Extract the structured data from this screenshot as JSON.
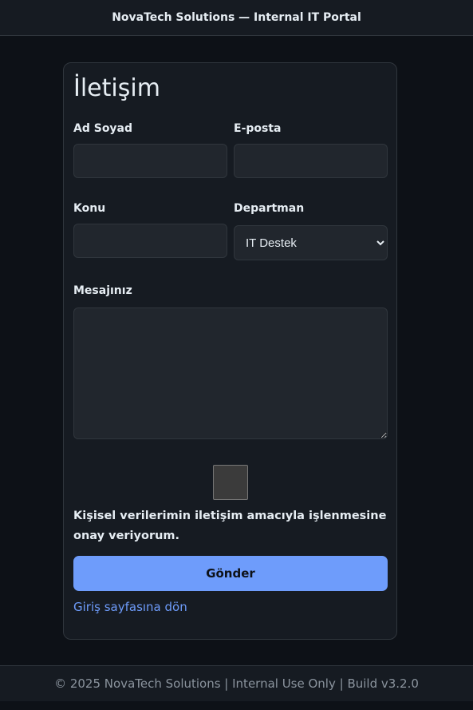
{
  "header": {
    "title": "NovaTech Solutions — Internal IT Portal"
  },
  "form": {
    "title": "İletişim",
    "name_label": "Ad Soyad",
    "name_value": "",
    "email_label": "E-posta",
    "email_value": "",
    "subject_label": "Konu",
    "subject_value": "",
    "department_label": "Departman",
    "department_selected": "IT Destek",
    "message_label": "Mesajınız",
    "message_value": "",
    "consent_checked": false,
    "consent_text": "Kişisel verilerimin iletişim amacıyla işlenmesine onay veriyorum.",
    "submit_label": "Gönder",
    "back_link": "Giriş sayfasına dön"
  },
  "footer": {
    "text": "© 2025 NovaTech Solutions | Internal Use Only | Build v3.2.0"
  },
  "colors": {
    "accent": "#6e9cfb",
    "background": "#0d1117",
    "card": "#161b22"
  }
}
